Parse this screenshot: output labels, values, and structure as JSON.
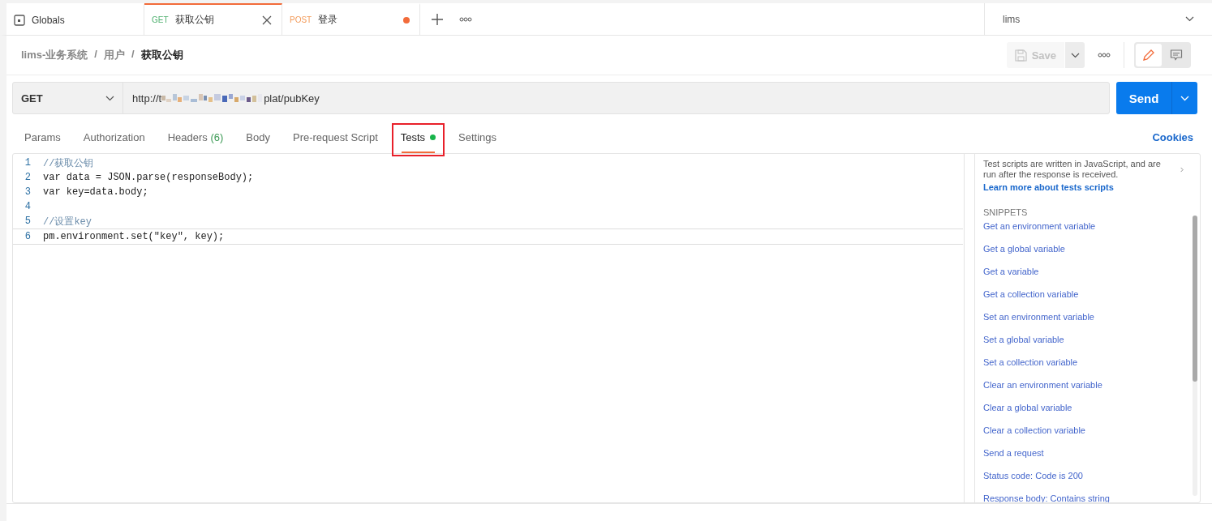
{
  "tabs": [
    {
      "kind": "globals",
      "label": "Globals",
      "selected": false
    },
    {
      "kind": "request",
      "method": "GET",
      "label": "获取公钥",
      "selected": true,
      "unsaved": false
    },
    {
      "kind": "request",
      "method": "POST",
      "label": "登录",
      "selected": false,
      "unsaved": true
    }
  ],
  "environment": {
    "value": "lims"
  },
  "breadcrumb": {
    "separator": "/",
    "items": [
      "lims-业务系统",
      "用户",
      "获取公钥"
    ]
  },
  "view_modes": [
    {
      "kind": "edit",
      "selected": true
    },
    {
      "kind": "comments",
      "selected": false
    }
  ],
  "save_button": {
    "label": "Save",
    "disabled": true
  },
  "request": {
    "method": "GET",
    "url_start": "http://t",
    "url_end": "plat/pubKey",
    "send": "Send"
  },
  "request_tabs": [
    {
      "label": "Params",
      "selected": false
    },
    {
      "label": "Authorization",
      "selected": false
    },
    {
      "label": "Headers",
      "count": "(6)",
      "selected": false
    },
    {
      "label": "Body",
      "selected": false
    },
    {
      "label": "Pre-request Script",
      "selected": false
    },
    {
      "label": "Tests",
      "selected": true,
      "has_content": true,
      "highlighted": true
    },
    {
      "label": "Settings",
      "selected": false
    }
  ],
  "cookies_link": "Cookies",
  "editor": {
    "lines": [
      {
        "number": "1",
        "text": "//获取公钥",
        "kind": "comment"
      },
      {
        "number": "2",
        "text": "var data = JSON.parse(responseBody);",
        "kind": "code"
      },
      {
        "number": "3",
        "text": "var key=data.body;",
        "kind": "code"
      },
      {
        "number": "4",
        "kind": "blank"
      },
      {
        "number": "5",
        "text": "//设置key",
        "kind": "comment"
      },
      {
        "number": "6",
        "text": "pm.environment.set(\"key\", key);",
        "kind": "code",
        "current": true
      }
    ]
  },
  "snippets_panel": {
    "intro": "Test scripts are written in JavaScript, and are run after the response is received.",
    "learn_more": "Learn more about tests scripts",
    "heading": "SNIPPETS",
    "items": [
      "Get an environment variable",
      "Get a global variable",
      "Get a variable",
      "Get a collection variable",
      "Set an environment variable",
      "Set a global variable",
      "Set a collection variable",
      "Clear an environment variable",
      "Clear a global variable",
      "Clear a collection variable",
      "Send a request",
      "Status code: Code is 200",
      "Response body: Contains string"
    ]
  }
}
